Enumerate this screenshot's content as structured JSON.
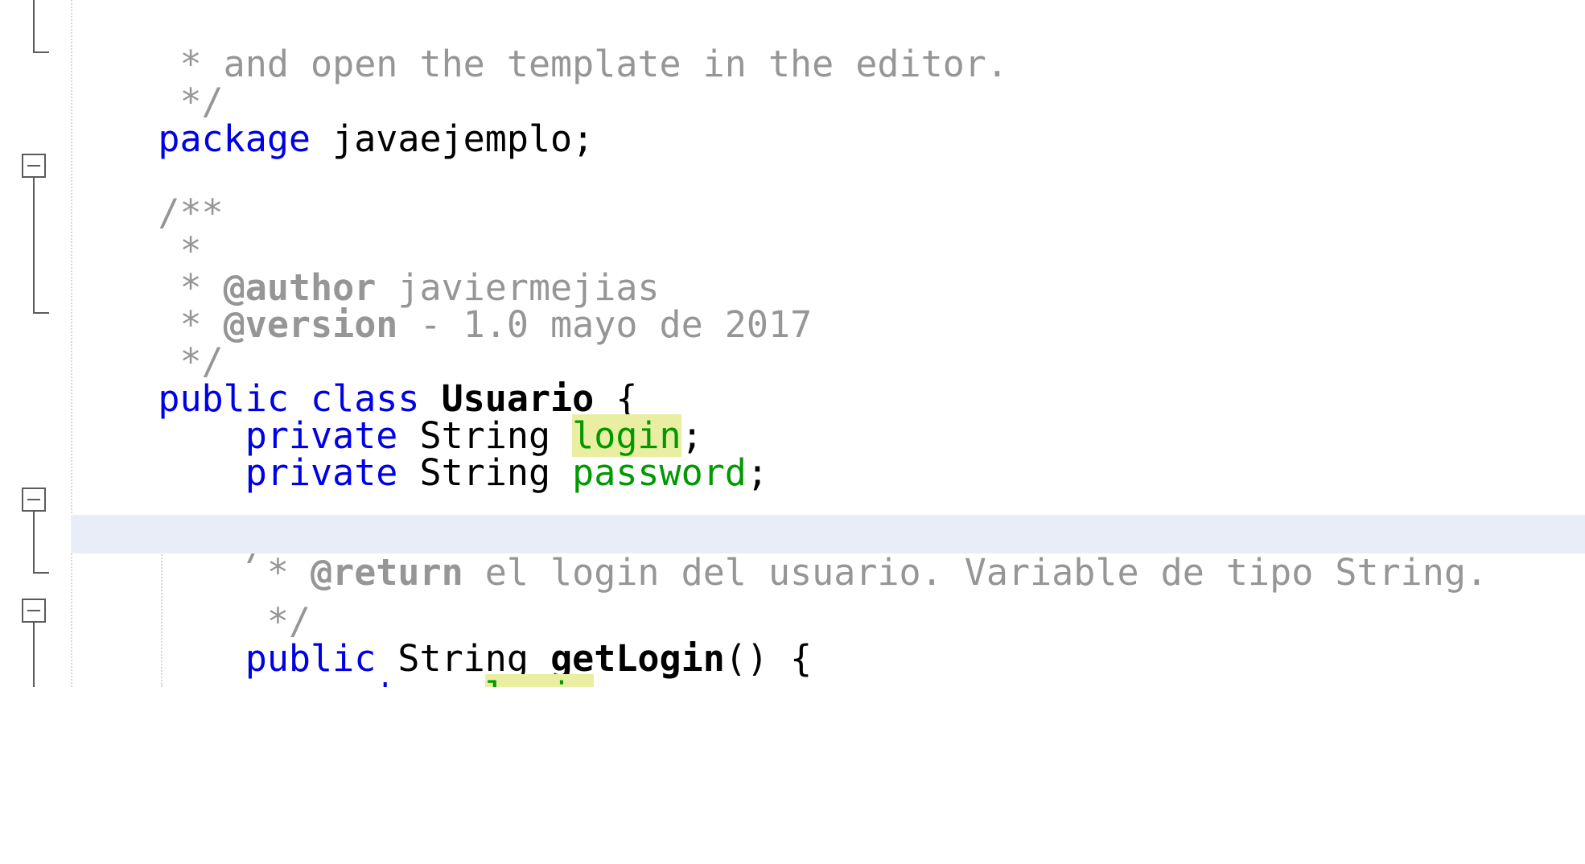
{
  "editor": {
    "language": "java",
    "colors": {
      "keyword": "#0000e6",
      "comment": "#969696",
      "field": "#009900",
      "occurrence_highlight": "#eaeea3",
      "current_line": "#e8edf7"
    },
    "lines": {
      "l1": {
        "prefix": " * ",
        "text": "and open the template in the editor."
      },
      "l2": {
        "text": " */"
      },
      "l3": {
        "kw": "package",
        "name": " javaejemplo;"
      },
      "l5": {
        "text": "/**"
      },
      "l6": {
        "text": " *"
      },
      "l7": {
        "prefix": " * ",
        "tag": "@author",
        "rest": " javiermejias"
      },
      "l8": {
        "prefix": " * ",
        "tag": "@version",
        "rest": " - 1.0 mayo de 2017"
      },
      "l9": {
        "text": " */"
      },
      "l10": {
        "kw1": "public",
        "kw2": " class",
        "sp": " ",
        "name": "Usuario",
        "rest": " {"
      },
      "l11": {
        "indent": "    ",
        "kw": "private",
        "type": " String ",
        "field": "login",
        "rest": ";"
      },
      "l12": {
        "indent": "    ",
        "kw": "private",
        "type": " String ",
        "field": "password",
        "rest": ";"
      },
      "l14": {
        "text": "    /**"
      },
      "l15": {
        "prefix": "     * ",
        "tag": "@return",
        "rest": " el login del usuario. Variable de tipo String."
      },
      "l16": {
        "text": "     */"
      },
      "l17": {
        "indent": "    ",
        "kw": "public",
        "type": " String ",
        "method": "getLogin",
        "rest": "() {"
      },
      "l18": {
        "indent": "        ",
        "kw": "return",
        "sp": " ",
        "field": "login",
        "rest": ";"
      },
      "l19": {
        "text": "    }"
      }
    }
  }
}
